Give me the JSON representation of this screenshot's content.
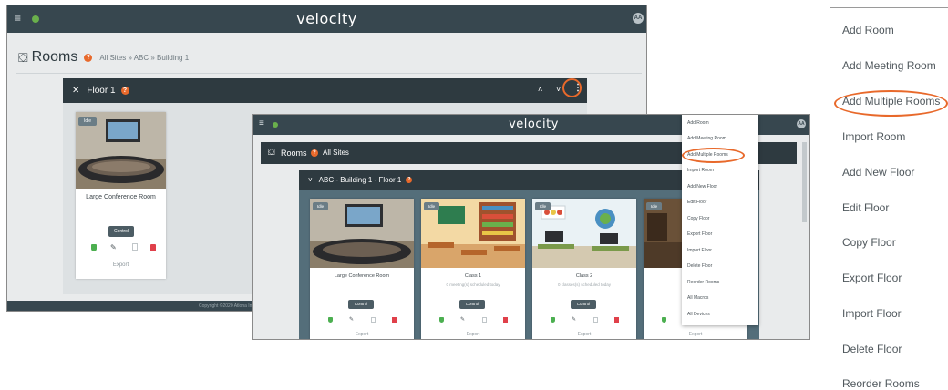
{
  "app": {
    "brand": "velocity",
    "user_initials": "AA"
  },
  "shot1": {
    "page_title": "Rooms",
    "breadcrumb": "All Sites » ABC » Building 1",
    "floor_label": "Floor 1",
    "room": {
      "badge": "Idle",
      "name": "Large Conference Room",
      "control_label": "Control",
      "export_label": "Export"
    },
    "footer": "Copyright ©2020 Atlona Inc"
  },
  "shot2": {
    "page_title": "Rooms",
    "breadcrumb": "All Sites",
    "floor_label": "ABC - Building 1 - Floor 1",
    "rooms": [
      {
        "badge": "Idle",
        "name": "Large Conference Room",
        "schedule": "",
        "control_label": "Control",
        "export_label": "Export"
      },
      {
        "badge": "Idle",
        "name": "Class 1",
        "schedule": "0 meeting(s) scheduled today",
        "control_label": "Control",
        "export_label": "Export"
      },
      {
        "badge": "Idle",
        "name": "Class 2",
        "schedule": "0 classes(s) scheduled today",
        "control_label": "Control",
        "export_label": "Export"
      },
      {
        "badge": "Idle",
        "name": "Me",
        "schedule": "0 meeti",
        "control_label": "Control",
        "export_label": "Export"
      }
    ],
    "menu": [
      "Add Room",
      "Add Meeting Room",
      "Add Multiple Rooms",
      "Import Room",
      "Add New Floor",
      "Edit Floor",
      "Copy Floor",
      "Export Floor",
      "Import Floor",
      "Delete Floor",
      "Reorder Rooms",
      "All Macros",
      "All Devices"
    ]
  },
  "zoom_menu": [
    "Add Room",
    "Add Meeting Room",
    "Add Multiple Rooms",
    "Import Room",
    "Add New Floor",
    "Edit Floor",
    "Copy Floor",
    "Export Floor",
    "Import Floor",
    "Delete Floor",
    "Reorder Rooms"
  ],
  "colors": {
    "topbar": "#37474f",
    "accent": "#e8692b",
    "brand_green": "#6ab04c",
    "delete_red": "#e0404a"
  }
}
